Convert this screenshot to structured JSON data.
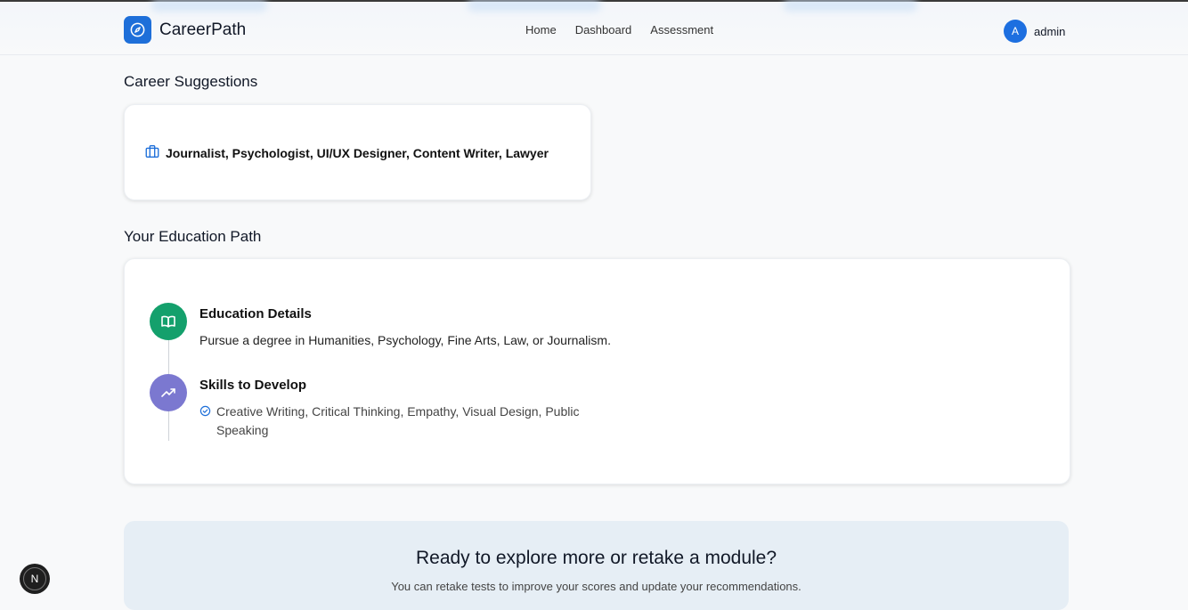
{
  "header": {
    "logo_text": "CareerPath",
    "nav": [
      "Home",
      "Dashboard",
      "Assessment"
    ],
    "avatar_letter": "A",
    "username": "admin"
  },
  "career": {
    "heading": "Career Suggestions",
    "suggestions": "Journalist, Psychologist, UI/UX Designer, Content Writer, Lawyer"
  },
  "education": {
    "heading": "Your Education Path",
    "details_title": "Education Details",
    "details_text": "Pursue a degree in Humanities, Psychology, Fine Arts, Law, or Journalism.",
    "skills_title": "Skills to Develop",
    "skills_text": "Creative Writing, Critical Thinking, Empathy, Visual Design, Public Speaking"
  },
  "cta": {
    "title": "Ready to explore more or retake a module?",
    "subtitle": "You can retake tests to improve your scores and update your recommendations."
  },
  "fab": {
    "letter": "N"
  },
  "colors": {
    "brand": "#1e6fd9",
    "details_accent": "#14a06c",
    "skills_accent": "#7b78d0",
    "cta_bg": "#e6eef5"
  },
  "icons": [
    "compass-icon",
    "briefcase-icon",
    "book-open-icon",
    "trending-up-icon",
    "check-circle-icon"
  ]
}
